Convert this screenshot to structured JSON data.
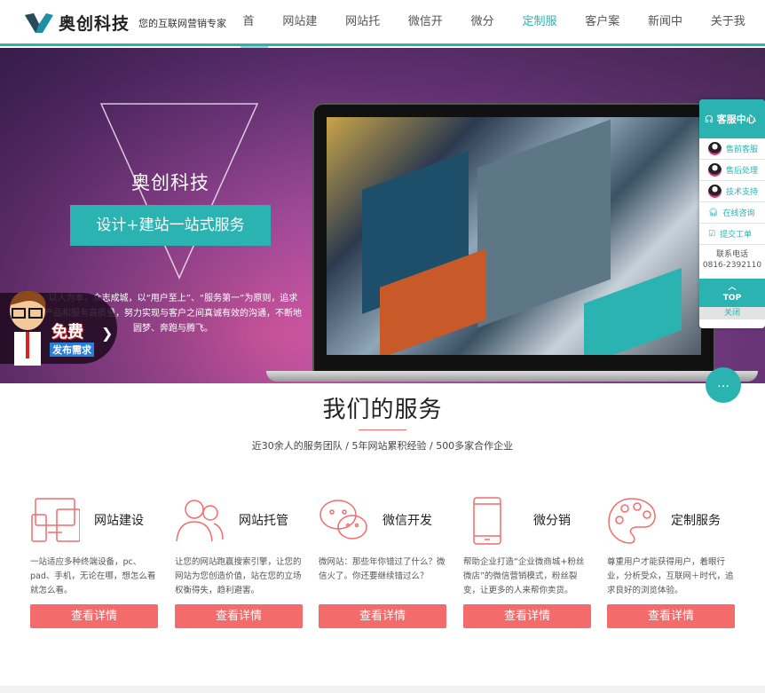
{
  "header": {
    "brand": "奥创科技",
    "slogan": "您的互联网营销专家",
    "nav": [
      {
        "label": "首页"
      },
      {
        "label": "网站建设"
      },
      {
        "label": "网站托管"
      },
      {
        "label": "微信开发"
      },
      {
        "label": "微分销"
      },
      {
        "label": "定制服务"
      },
      {
        "label": "客户案例"
      },
      {
        "label": "新闻中心"
      },
      {
        "label": "关于我们"
      }
    ],
    "active": "定制服务",
    "accent": "#2ab3b1"
  },
  "hero": {
    "brand": "奥创科技",
    "tagline": "设计+建站一站式服务",
    "text": "以人为本，众志成城，以“用户至上”、“服务第一”为原则，追求产品和服务高质量，努力实现与客户之间真诚有效的沟通，不断地圆梦、奔跑与腾飞。"
  },
  "promo": {
    "free": "免费",
    "publish": "发布需求"
  },
  "service_panel": {
    "title": "客服中心",
    "items": [
      {
        "label": "售前客服",
        "icon": "qq-icon"
      },
      {
        "label": "售后处理",
        "icon": "qq-icon"
      },
      {
        "label": "技术支持",
        "icon": "qq-icon"
      },
      {
        "label": "在线咨询",
        "icon": "headset-icon"
      },
      {
        "label": "提交工单",
        "icon": "checkbox-icon"
      }
    ],
    "phone_label": "联系电话",
    "phone": "0816-2392110",
    "top": "TOP",
    "close": "关闭"
  },
  "services": {
    "title": "我们的服务",
    "subtitle": "近30余人的服务团队 / 5年网站累积经验 / 500多家合作企业",
    "cards": [
      {
        "title": "网站建设",
        "icon": "devices-icon",
        "desc": "一站适应多种终端设备，pc、pad、手机，无论在哪，想怎么看就怎么看。",
        "button": "查看详情"
      },
      {
        "title": "网站托管",
        "icon": "users-icon",
        "desc": "让您的网站跑赢搜索引擎，让您的网站为您创造价值，站在您的立场权衡得失，趋利避害。",
        "button": "查看详情"
      },
      {
        "title": "微信开发",
        "icon": "wechat-icon",
        "desc": "微网站：那些年你错过了什么？微信火了。你还要继续错过么？",
        "button": "查看详情"
      },
      {
        "title": "微分销",
        "icon": "phone-icon",
        "desc": "帮助企业打造“企业微商城+粉丝微店”的微信营销模式，粉丝裂变，让更多的人来帮你卖货。",
        "button": "查看详情"
      },
      {
        "title": "定制服务",
        "icon": "palette-icon",
        "desc": "尊重用户才能获得用户，着眼行业，分析受众，互联网＋时代，追求良好的浏览体验。",
        "button": "查看详情"
      }
    ],
    "accent": "#f46b6b"
  }
}
